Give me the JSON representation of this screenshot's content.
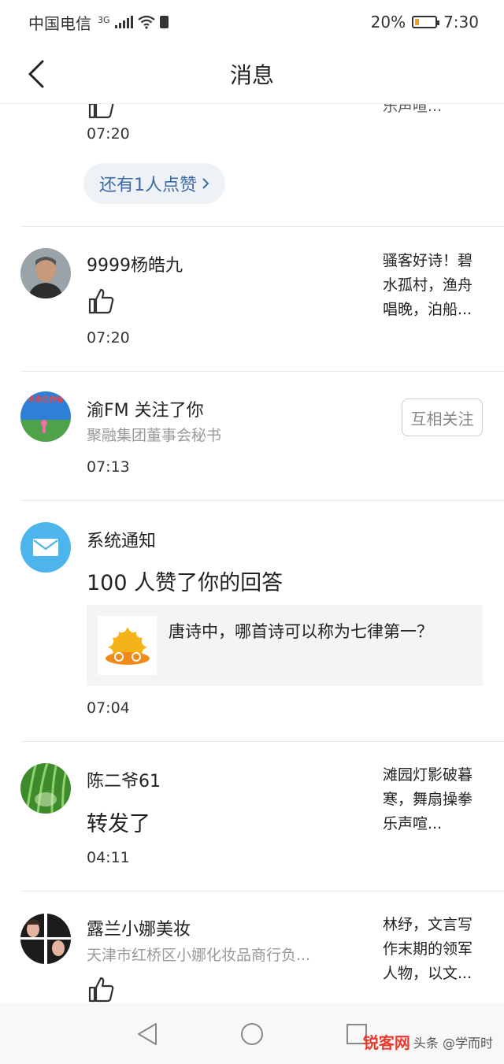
{
  "status_bar": {
    "carrier": "中国电信",
    "network": "3G",
    "battery_percent": "20%",
    "battery_level": 0.2,
    "time": "7:30"
  },
  "header": {
    "title": "消息",
    "back_icon": "chevron-left-icon"
  },
  "messages": [
    {
      "type": "like-partial",
      "time": "07:20",
      "snippet_lines": [
        "乐声喧..."
      ],
      "more_likes_label": "还有1人点赞"
    },
    {
      "type": "like",
      "name": "9999杨皓九",
      "time": "07:20",
      "snippet_lines": [
        "骚客好诗！碧",
        "水孤村，渔舟",
        "唱晚，泊船..."
      ]
    },
    {
      "type": "follow",
      "name": "渝FM 关注了你",
      "subtitle": "聚融集团董事会秘书",
      "time": "07:13",
      "button_label": "互相关注",
      "avatar_caption": "头条创作者"
    },
    {
      "type": "system",
      "name": "系统通知",
      "headline": "100 人赞了你的回答",
      "quote_text": "唐诗中，哪首诗可以称为七律第一？",
      "time": "07:04"
    },
    {
      "type": "repost",
      "name": "陈二爷61",
      "action": "转发了",
      "time": "04:11",
      "snippet_lines": [
        "滩园灯影破暮",
        "寒，舞扇操拳",
        "乐声喧..."
      ]
    },
    {
      "type": "like",
      "name": "露兰小娜美妆",
      "subtitle": "天津市红桥区小娜化妆品商行负...",
      "snippet_lines": [
        "林纾，文言写",
        "作末期的领军",
        "人物，以文..."
      ]
    }
  ],
  "nav_bar": {
    "back_icon": "triangle-back-icon",
    "home_icon": "circle-home-icon",
    "recents_icon": "square-recents-icon"
  },
  "watermark": {
    "logo": "锐客网",
    "text": "头条 @学而时"
  }
}
